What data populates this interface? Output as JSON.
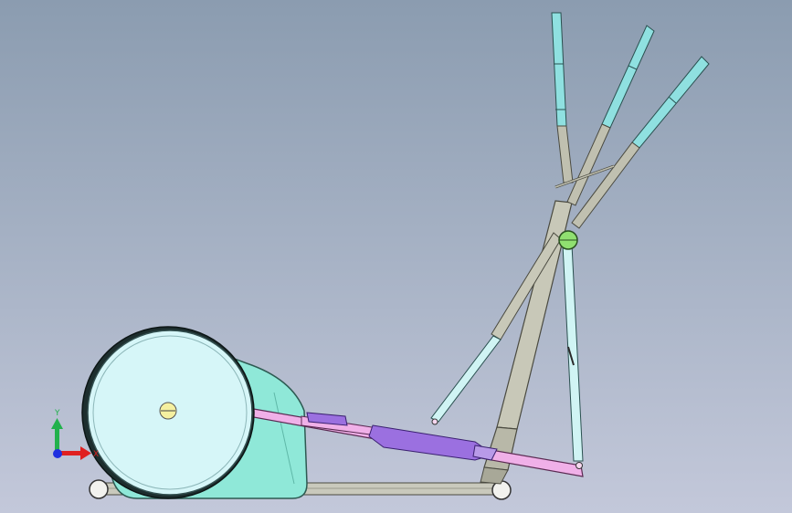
{
  "viewport": {
    "background_top": "#8b9cb0",
    "background_bottom": "#c3c8da"
  },
  "triad": {
    "y_label": "Y",
    "x_label": "X",
    "y_color": "#22b14c",
    "x_color": "#e02020",
    "z_color": "#2030e0"
  },
  "model": {
    "flywheel_color": "#d6f6f8",
    "housing_color": "#8fe8d8",
    "handle_tip_color": "#8fe0e0",
    "link_color": "#f0b0e8",
    "pedal_color": "#9b70e0",
    "frame_color": "#c0c0b0",
    "pivot_color": "#90e070"
  }
}
